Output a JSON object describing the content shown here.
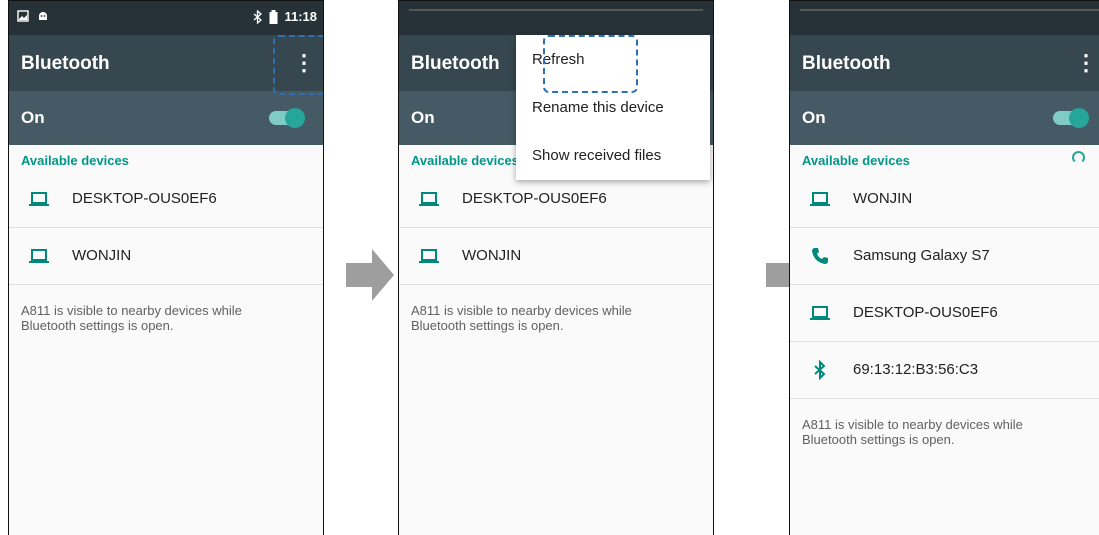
{
  "colors": {
    "statusbar": "#263238",
    "appbar": "#37474f",
    "switchbar": "#455a64",
    "accent": "#009688",
    "highlight": "#2e6fb5"
  },
  "screen1": {
    "status_time": "11:18",
    "title": "Bluetooth",
    "switch_label": "On",
    "section_label": "Available devices",
    "devices": [
      {
        "name": "DESKTOP-OUS0EF6",
        "icon": "laptop-icon"
      },
      {
        "name": "WONJIN",
        "icon": "laptop-icon"
      }
    ],
    "note": "A811 is visible to nearby devices while\nBluetooth settings is open."
  },
  "screen2": {
    "title": "Bluetooth",
    "switch_label": "On",
    "section_label": "Available devices",
    "menu_items": [
      "Refresh",
      "Rename this device",
      "Show received files"
    ],
    "devices": [
      {
        "name": "DESKTOP-OUS0EF6",
        "icon": "laptop-icon"
      },
      {
        "name": "WONJIN",
        "icon": "laptop-icon"
      }
    ],
    "note": "A811 is visible to nearby devices while\nBluetooth settings is open."
  },
  "screen3": {
    "title": "Bluetooth",
    "switch_label": "On",
    "section_label": "Available devices",
    "devices": [
      {
        "name": "WONJIN",
        "icon": "laptop-icon"
      },
      {
        "name": "Samsung Galaxy S7",
        "icon": "phone-icon"
      },
      {
        "name": "DESKTOP-OUS0EF6",
        "icon": "laptop-icon"
      },
      {
        "name": "69:13:12:B3:56:C3",
        "icon": "bluetooth-icon"
      }
    ],
    "note": "A811 is visible to nearby devices while\nBluetooth settings is open."
  }
}
